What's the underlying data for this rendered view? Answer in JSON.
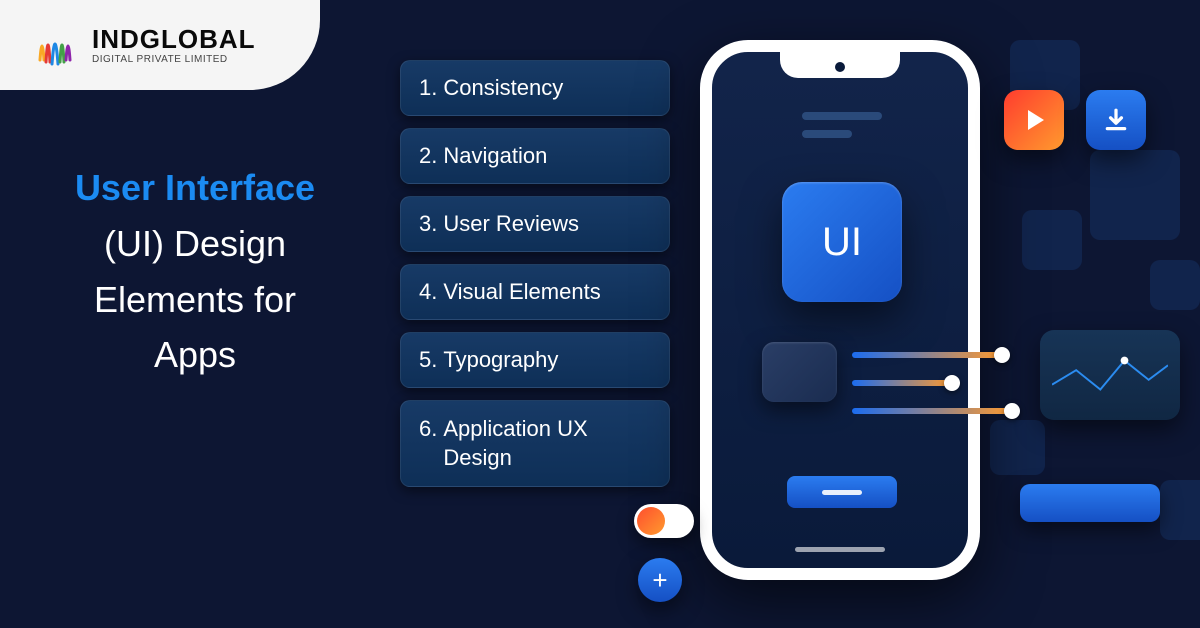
{
  "brand": {
    "name": "INDGLOBAL",
    "subtitle": "DIGITAL PRIVATE LIMITED"
  },
  "heading": {
    "line1": "User Interface",
    "line2": "(UI) Design",
    "line3": "Elements for",
    "line4": "Apps"
  },
  "list": {
    "items": [
      {
        "num": "1.",
        "label": "Consistency"
      },
      {
        "num": "2.",
        "label": "Navigation"
      },
      {
        "num": "3.",
        "label": "User Reviews"
      },
      {
        "num": "4.",
        "label": "Visual Elements"
      },
      {
        "num": "5.",
        "label": "Typography"
      },
      {
        "num": "6.",
        "label": "Application UX Design"
      }
    ]
  },
  "phone": {
    "tile_label": "UI"
  },
  "icons": {
    "plus": "+"
  },
  "colors": {
    "accent": "#1b8bf2",
    "bg": "#0d1633"
  }
}
